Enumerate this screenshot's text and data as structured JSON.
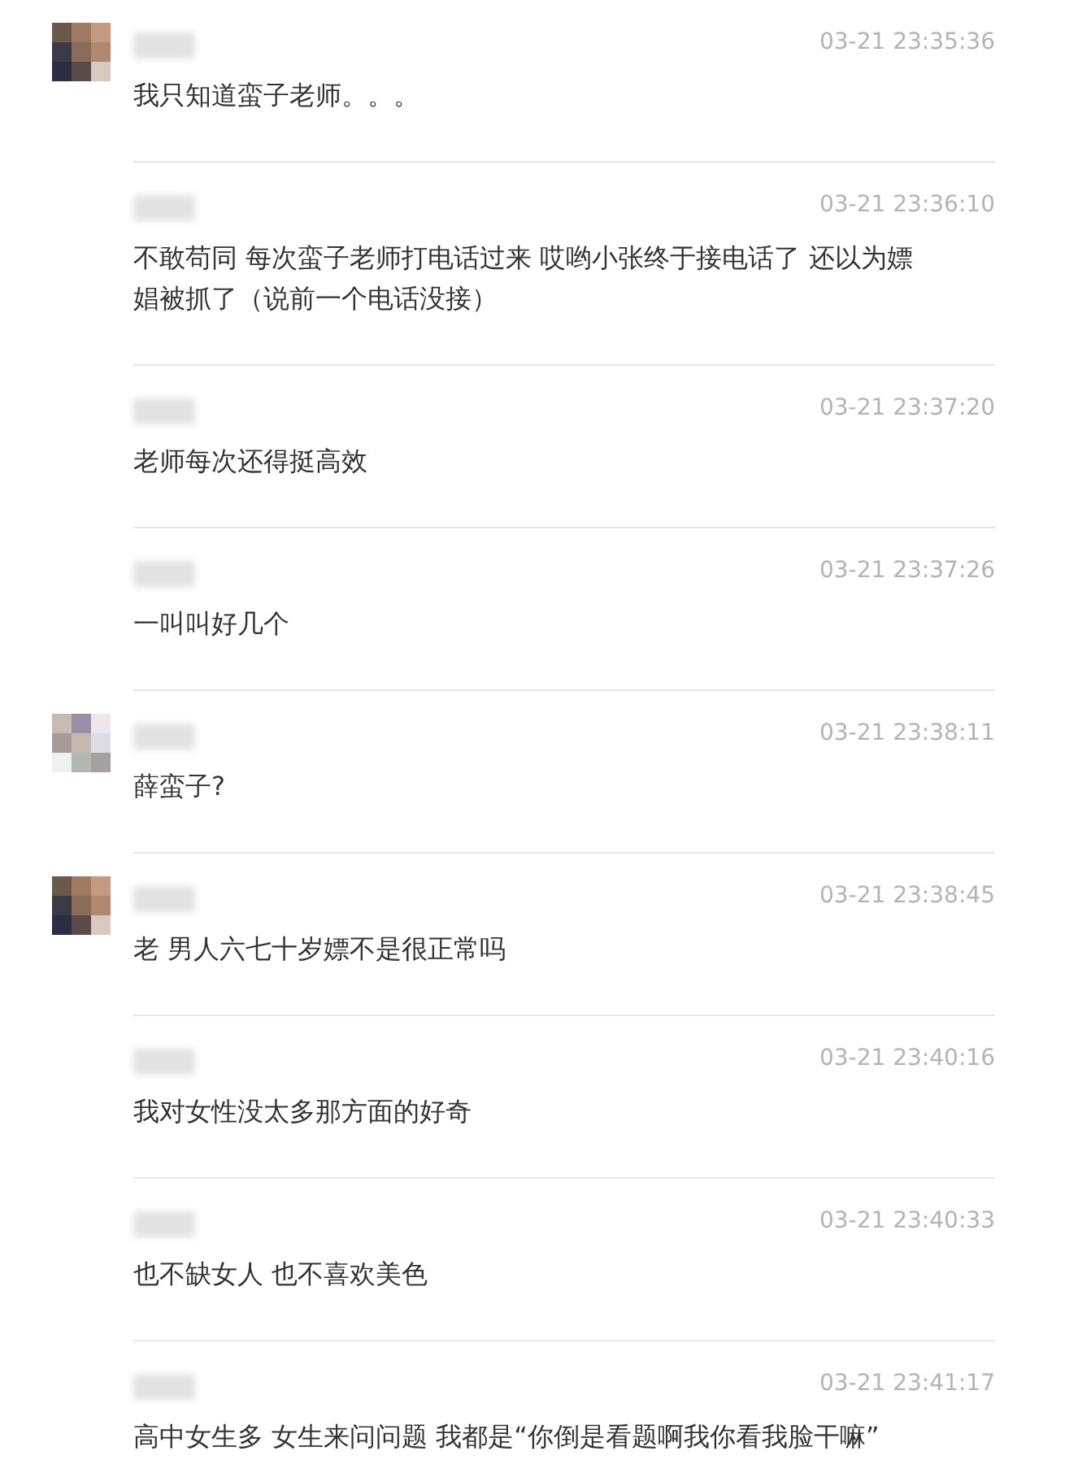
{
  "messages": [
    {
      "time": "03-21 23:35:36",
      "text": "我只知道蛮子老师。。。"
    },
    {
      "kind": "plain",
      "time": "03-21 23:36:10",
      "text": "不敢苟同 每次蛮子老师打电话过来 哎哟小张终于接电话了 还以为嫖娼被抓了（说前一个电话没接）"
    },
    {
      "kind": "plain",
      "time": "03-21 23:37:20",
      "text": "老师每次还得挺高效"
    },
    {
      "kind": "plain",
      "time": "03-21 23:37:26",
      "text": "一叫叫好几个"
    },
    {
      "kind": "mosaic",
      "time": "03-21 23:38:11",
      "text": "薛蛮子?"
    },
    {
      "time": "03-21 23:38:45",
      "text": "老 男人六七十岁嫖不是很正常吗"
    },
    {
      "kind": "plain",
      "time": "03-21 23:40:16",
      "text": "我对女性没太多那方面的好奇"
    },
    {
      "kind": "plain",
      "time": "03-21 23:40:33",
      "text": "也不缺女人 也不喜欢美色"
    },
    {
      "kind": "plain",
      "time": "03-21 23:41:17",
      "text": "高中女生多 女生来问问题 我都是“你倒是看题啊我你看我脸干嘛”"
    }
  ]
}
